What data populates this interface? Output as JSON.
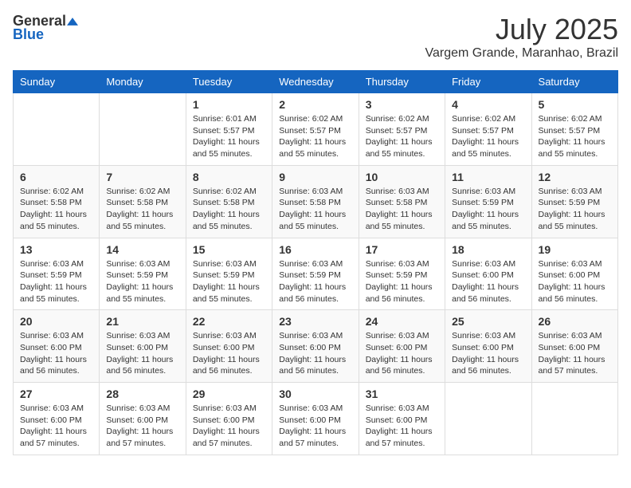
{
  "header": {
    "logo": {
      "general": "General",
      "blue": "Blue"
    },
    "title": "July 2025",
    "location": "Vargem Grande, Maranhao, Brazil"
  },
  "calendar": {
    "days_of_week": [
      "Sunday",
      "Monday",
      "Tuesday",
      "Wednesday",
      "Thursday",
      "Friday",
      "Saturday"
    ],
    "weeks": [
      [
        {
          "day": "",
          "info": ""
        },
        {
          "day": "",
          "info": ""
        },
        {
          "day": "1",
          "info": "Sunrise: 6:01 AM\nSunset: 5:57 PM\nDaylight: 11 hours and 55 minutes."
        },
        {
          "day": "2",
          "info": "Sunrise: 6:02 AM\nSunset: 5:57 PM\nDaylight: 11 hours and 55 minutes."
        },
        {
          "day": "3",
          "info": "Sunrise: 6:02 AM\nSunset: 5:57 PM\nDaylight: 11 hours and 55 minutes."
        },
        {
          "day": "4",
          "info": "Sunrise: 6:02 AM\nSunset: 5:57 PM\nDaylight: 11 hours and 55 minutes."
        },
        {
          "day": "5",
          "info": "Sunrise: 6:02 AM\nSunset: 5:57 PM\nDaylight: 11 hours and 55 minutes."
        }
      ],
      [
        {
          "day": "6",
          "info": "Sunrise: 6:02 AM\nSunset: 5:58 PM\nDaylight: 11 hours and 55 minutes."
        },
        {
          "day": "7",
          "info": "Sunrise: 6:02 AM\nSunset: 5:58 PM\nDaylight: 11 hours and 55 minutes."
        },
        {
          "day": "8",
          "info": "Sunrise: 6:02 AM\nSunset: 5:58 PM\nDaylight: 11 hours and 55 minutes."
        },
        {
          "day": "9",
          "info": "Sunrise: 6:03 AM\nSunset: 5:58 PM\nDaylight: 11 hours and 55 minutes."
        },
        {
          "day": "10",
          "info": "Sunrise: 6:03 AM\nSunset: 5:58 PM\nDaylight: 11 hours and 55 minutes."
        },
        {
          "day": "11",
          "info": "Sunrise: 6:03 AM\nSunset: 5:59 PM\nDaylight: 11 hours and 55 minutes."
        },
        {
          "day": "12",
          "info": "Sunrise: 6:03 AM\nSunset: 5:59 PM\nDaylight: 11 hours and 55 minutes."
        }
      ],
      [
        {
          "day": "13",
          "info": "Sunrise: 6:03 AM\nSunset: 5:59 PM\nDaylight: 11 hours and 55 minutes."
        },
        {
          "day": "14",
          "info": "Sunrise: 6:03 AM\nSunset: 5:59 PM\nDaylight: 11 hours and 55 minutes."
        },
        {
          "day": "15",
          "info": "Sunrise: 6:03 AM\nSunset: 5:59 PM\nDaylight: 11 hours and 55 minutes."
        },
        {
          "day": "16",
          "info": "Sunrise: 6:03 AM\nSunset: 5:59 PM\nDaylight: 11 hours and 56 minutes."
        },
        {
          "day": "17",
          "info": "Sunrise: 6:03 AM\nSunset: 5:59 PM\nDaylight: 11 hours and 56 minutes."
        },
        {
          "day": "18",
          "info": "Sunrise: 6:03 AM\nSunset: 6:00 PM\nDaylight: 11 hours and 56 minutes."
        },
        {
          "day": "19",
          "info": "Sunrise: 6:03 AM\nSunset: 6:00 PM\nDaylight: 11 hours and 56 minutes."
        }
      ],
      [
        {
          "day": "20",
          "info": "Sunrise: 6:03 AM\nSunset: 6:00 PM\nDaylight: 11 hours and 56 minutes."
        },
        {
          "day": "21",
          "info": "Sunrise: 6:03 AM\nSunset: 6:00 PM\nDaylight: 11 hours and 56 minutes."
        },
        {
          "day": "22",
          "info": "Sunrise: 6:03 AM\nSunset: 6:00 PM\nDaylight: 11 hours and 56 minutes."
        },
        {
          "day": "23",
          "info": "Sunrise: 6:03 AM\nSunset: 6:00 PM\nDaylight: 11 hours and 56 minutes."
        },
        {
          "day": "24",
          "info": "Sunrise: 6:03 AM\nSunset: 6:00 PM\nDaylight: 11 hours and 56 minutes."
        },
        {
          "day": "25",
          "info": "Sunrise: 6:03 AM\nSunset: 6:00 PM\nDaylight: 11 hours and 56 minutes."
        },
        {
          "day": "26",
          "info": "Sunrise: 6:03 AM\nSunset: 6:00 PM\nDaylight: 11 hours and 57 minutes."
        }
      ],
      [
        {
          "day": "27",
          "info": "Sunrise: 6:03 AM\nSunset: 6:00 PM\nDaylight: 11 hours and 57 minutes."
        },
        {
          "day": "28",
          "info": "Sunrise: 6:03 AM\nSunset: 6:00 PM\nDaylight: 11 hours and 57 minutes."
        },
        {
          "day": "29",
          "info": "Sunrise: 6:03 AM\nSunset: 6:00 PM\nDaylight: 11 hours and 57 minutes."
        },
        {
          "day": "30",
          "info": "Sunrise: 6:03 AM\nSunset: 6:00 PM\nDaylight: 11 hours and 57 minutes."
        },
        {
          "day": "31",
          "info": "Sunrise: 6:03 AM\nSunset: 6:00 PM\nDaylight: 11 hours and 57 minutes."
        },
        {
          "day": "",
          "info": ""
        },
        {
          "day": "",
          "info": ""
        }
      ]
    ]
  }
}
